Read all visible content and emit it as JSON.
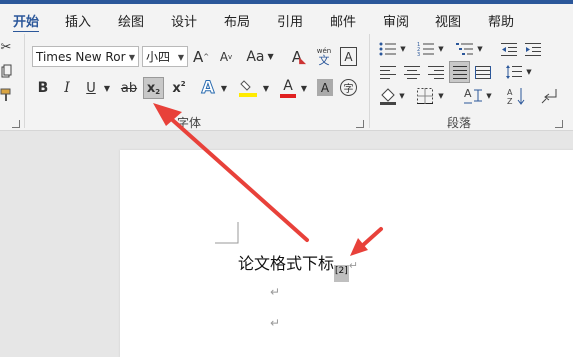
{
  "tabs": [
    "开始",
    "插入",
    "绘图",
    "设计",
    "布局",
    "引用",
    "邮件",
    "审阅",
    "视图",
    "帮助"
  ],
  "font": {
    "name": "Times New Ror",
    "size": "小四"
  },
  "buttons": {
    "grow": "A",
    "shrink": "A",
    "case": "Aa",
    "clear": "A",
    "phonetic_top": "wén",
    "phonetic_bottom": "文",
    "border_char": "A",
    "bold": "B",
    "italic": "I",
    "underline": "U",
    "strike": "ab",
    "subscript": "x",
    "superscript": "x",
    "effect": "A",
    "font_color": "A",
    "shade": "A",
    "enclose": "字",
    "paste_icon": "✂"
  },
  "groups": {
    "font": "字体",
    "paragraph": "段落"
  },
  "document": {
    "text": "论文格式下标",
    "subscript": "[2]",
    "mark": "↵"
  }
}
